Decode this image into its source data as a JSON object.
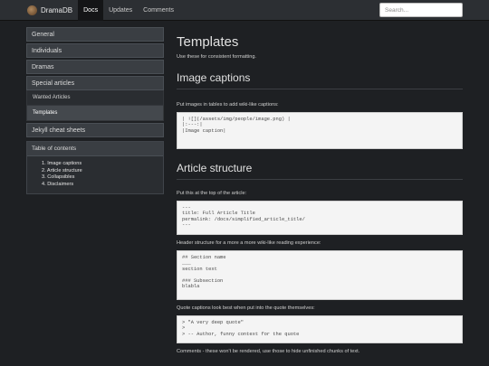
{
  "navbar": {
    "brand": "DramaDB",
    "links": [
      "Docs",
      "Updates",
      "Comments"
    ],
    "search_placeholder": "Search..."
  },
  "sidebar": {
    "items": [
      "General",
      "Individuals",
      "Dramas",
      "Special articles"
    ],
    "subitems": [
      "Wanted Articles",
      "Templates"
    ],
    "after_item": "Jekyll cheat sheets",
    "toc": {
      "title": "Table of contents",
      "entries": [
        "1. Image captions",
        "2. Article structure",
        "3. Collapsibles",
        "4. Disclaimers"
      ]
    }
  },
  "main": {
    "title": "Templates",
    "intro": "Use these for consistent formatting.",
    "image_captions": {
      "heading": "Image captions",
      "text": "Put images in tables to add wiki-like captions:",
      "code": "| ![](/assets/img/people/image.png) |\n|:---:|\n|Image caption|"
    },
    "article_structure": {
      "heading": "Article structure",
      "text1": "Put this at the top of the article:",
      "code1": "---\ntitle: Full Article Title\npermalink: /docs/simplified_article_title/\n---",
      "text2": "Header structure for a more a more wiki-like reading experience:",
      "code2": "## Section name\n___\nsection text\n\n### Subsection\nblabla",
      "text3": "Quote captions look best when put into the quote themselves:",
      "code3": "> \"A very deep quote\"\n>\n> -- Author, funny context for the quote",
      "text4": "Comments - these won't be rendered, use those to hide unfinished chunks of text."
    }
  }
}
